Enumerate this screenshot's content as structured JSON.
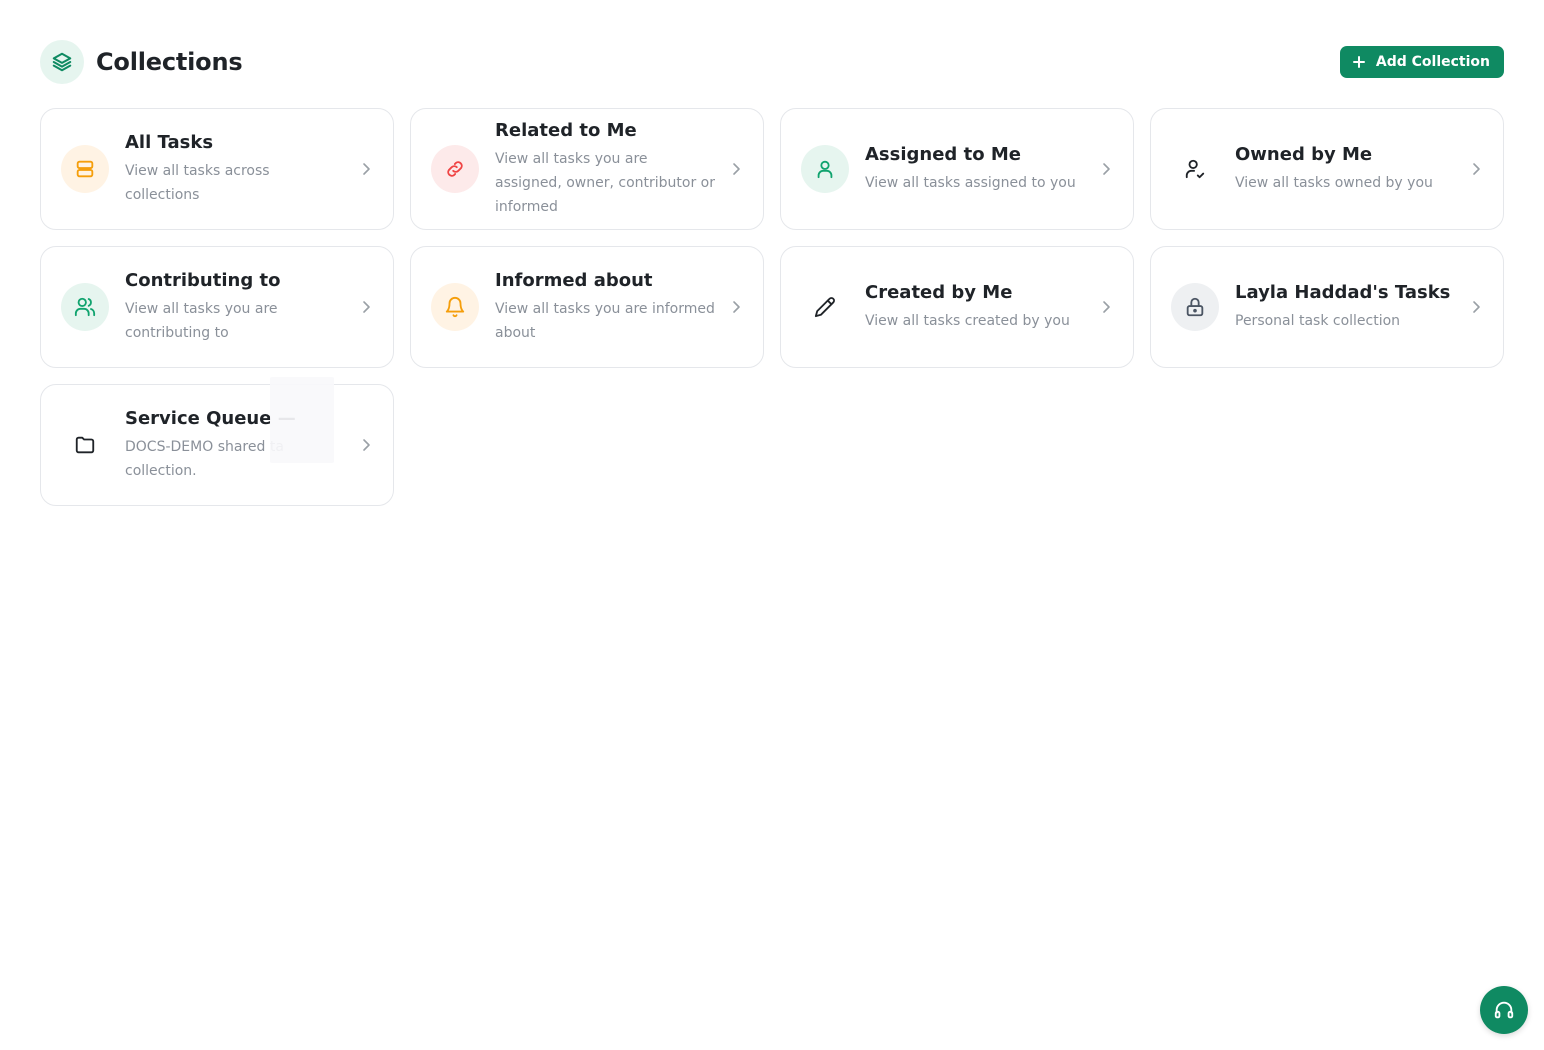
{
  "header": {
    "title": "Collections",
    "icon": "layers-icon",
    "add_button_label": "Add Collection"
  },
  "colors": {
    "brand": "#0f8a62",
    "orange": "#f59e0b",
    "red": "#ef4444",
    "green": "#10a36e",
    "gray": "#4b5563"
  },
  "collections": [
    {
      "title": "All Tasks",
      "description": "View all tasks across collections",
      "icon": "stack-icon"
    },
    {
      "title": "Related to Me",
      "description": "View all tasks you are assigned, owner, contributor or informed",
      "icon": "link-icon"
    },
    {
      "title": "Assigned to Me",
      "description": "View all tasks assigned to you",
      "icon": "user-icon"
    },
    {
      "title": "Owned by Me",
      "description": "View all tasks owned by you",
      "icon": "user-check-icon"
    },
    {
      "title": "Contributing to",
      "description": "View all tasks you are contributing to",
      "icon": "users-icon"
    },
    {
      "title": "Informed about",
      "description": "View all tasks you are informed about",
      "icon": "bell-icon"
    },
    {
      "title": "Created by Me",
      "description": "View all tasks created by you",
      "icon": "pencil-icon"
    },
    {
      "title": "Layla Haddad's Tasks",
      "description": "Personal task collection",
      "icon": "lock-icon"
    },
    {
      "title": "Service Queue —",
      "description": "DOCS-DEMO shared ta collection.",
      "icon": "folder-icon"
    }
  ],
  "support_button": {
    "icon": "headphones-icon"
  }
}
